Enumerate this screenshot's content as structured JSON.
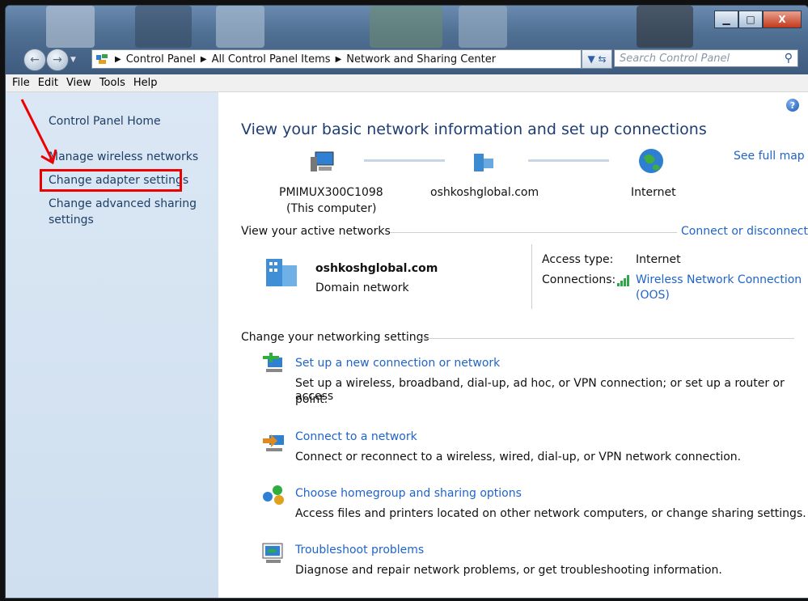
{
  "window": {
    "controls": {
      "minimize": "▁",
      "maximize": "□",
      "close": "X"
    }
  },
  "nav": {
    "back_glyph": "←",
    "forward_glyph": "→",
    "breadcrumbs": [
      "Control Panel",
      "All Control Panel Items",
      "Network and Sharing Center"
    ],
    "breadcrumb_separator": "▶",
    "refresh_glyph": "▼ ⇆",
    "search_placeholder": "Search Control Panel"
  },
  "menu": [
    "File",
    "Edit",
    "View",
    "Tools",
    "Help"
  ],
  "sidebar": {
    "home": "Control Panel Home",
    "items": [
      "Manage wireless networks",
      "Change adapter settings",
      "Change advanced sharing",
      "settings"
    ]
  },
  "main": {
    "title": "View your basic network information and set up connections",
    "see_full_map": "See full map",
    "map": {
      "computer": "PMIMUX300C1098",
      "computer_sub": "(This computer)",
      "domain": "oshkoshglobal.com",
      "internet": "Internet"
    },
    "active_networks": {
      "header": "View your active networks",
      "connect_link": "Connect or disconnect",
      "name": "oshkoshglobal.com",
      "type": "Domain network",
      "access_label": "Access type:",
      "access_value": "Internet",
      "connections_label": "Connections:",
      "connection_link_1": "Wireless Network Connection",
      "connection_link_2": "(OOS)"
    },
    "settings": {
      "header": "Change your networking settings",
      "items": [
        {
          "title": "Set up a new connection or network",
          "desc1": "Set up a wireless, broadband, dial-up, ad hoc, or VPN connection; or set up a router or access",
          "desc2": "point."
        },
        {
          "title": "Connect to a network",
          "desc1": "Connect or reconnect to a wireless, wired, dial-up, or VPN network connection.",
          "desc2": ""
        },
        {
          "title": "Choose homegroup and sharing options",
          "desc1": "Access files and printers located on other network computers, or change sharing settings.",
          "desc2": ""
        },
        {
          "title": "Troubleshoot problems",
          "desc1": "Diagnose and repair network problems, or get troubleshooting information.",
          "desc2": ""
        }
      ]
    }
  },
  "colors": {
    "link": "#1f64c8",
    "title": "#1e3e73",
    "highlight": "#ee0000",
    "sidebar": "#d6e4f2"
  }
}
